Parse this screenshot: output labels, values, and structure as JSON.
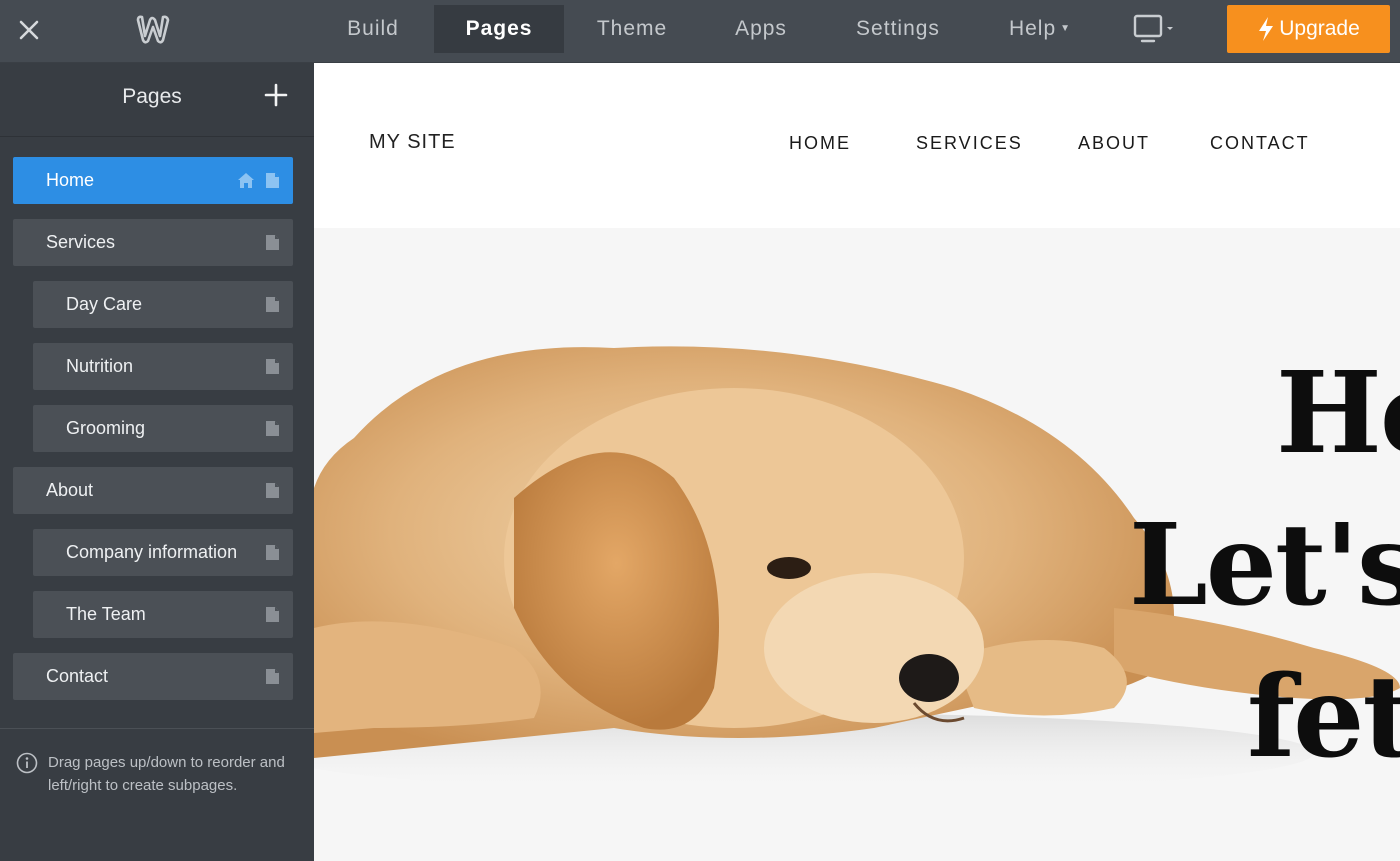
{
  "topbar": {
    "tabs": [
      {
        "label": "Build"
      },
      {
        "label": "Pages"
      },
      {
        "label": "Theme"
      },
      {
        "label": "Apps"
      },
      {
        "label": "Settings"
      },
      {
        "label": "Help"
      }
    ],
    "active_tab": "Pages",
    "upgrade_label": "Upgrade",
    "upgrade_color": "#f7901e"
  },
  "sidebar": {
    "title": "Pages",
    "items": [
      {
        "label": "Home",
        "level": 0,
        "active": true,
        "is_home": true
      },
      {
        "label": "Services",
        "level": 0
      },
      {
        "label": "Day Care",
        "level": 1
      },
      {
        "label": "Nutrition",
        "level": 1
      },
      {
        "label": "Grooming",
        "level": 1
      },
      {
        "label": "About",
        "level": 0
      },
      {
        "label": "Company information",
        "level": 1
      },
      {
        "label": "The Team",
        "level": 1
      },
      {
        "label": "Contact",
        "level": 0
      }
    ],
    "hint": "Drag pages up/down to reorder and left/right to create subpages.",
    "active_color": "#2d8ee4"
  },
  "site": {
    "logo": "MY SITE",
    "nav": [
      "HOME",
      "SERVICES",
      "ABOUT",
      "CONTACT"
    ],
    "hero_lines": [
      "He",
      "Let's",
      "fetc"
    ]
  }
}
